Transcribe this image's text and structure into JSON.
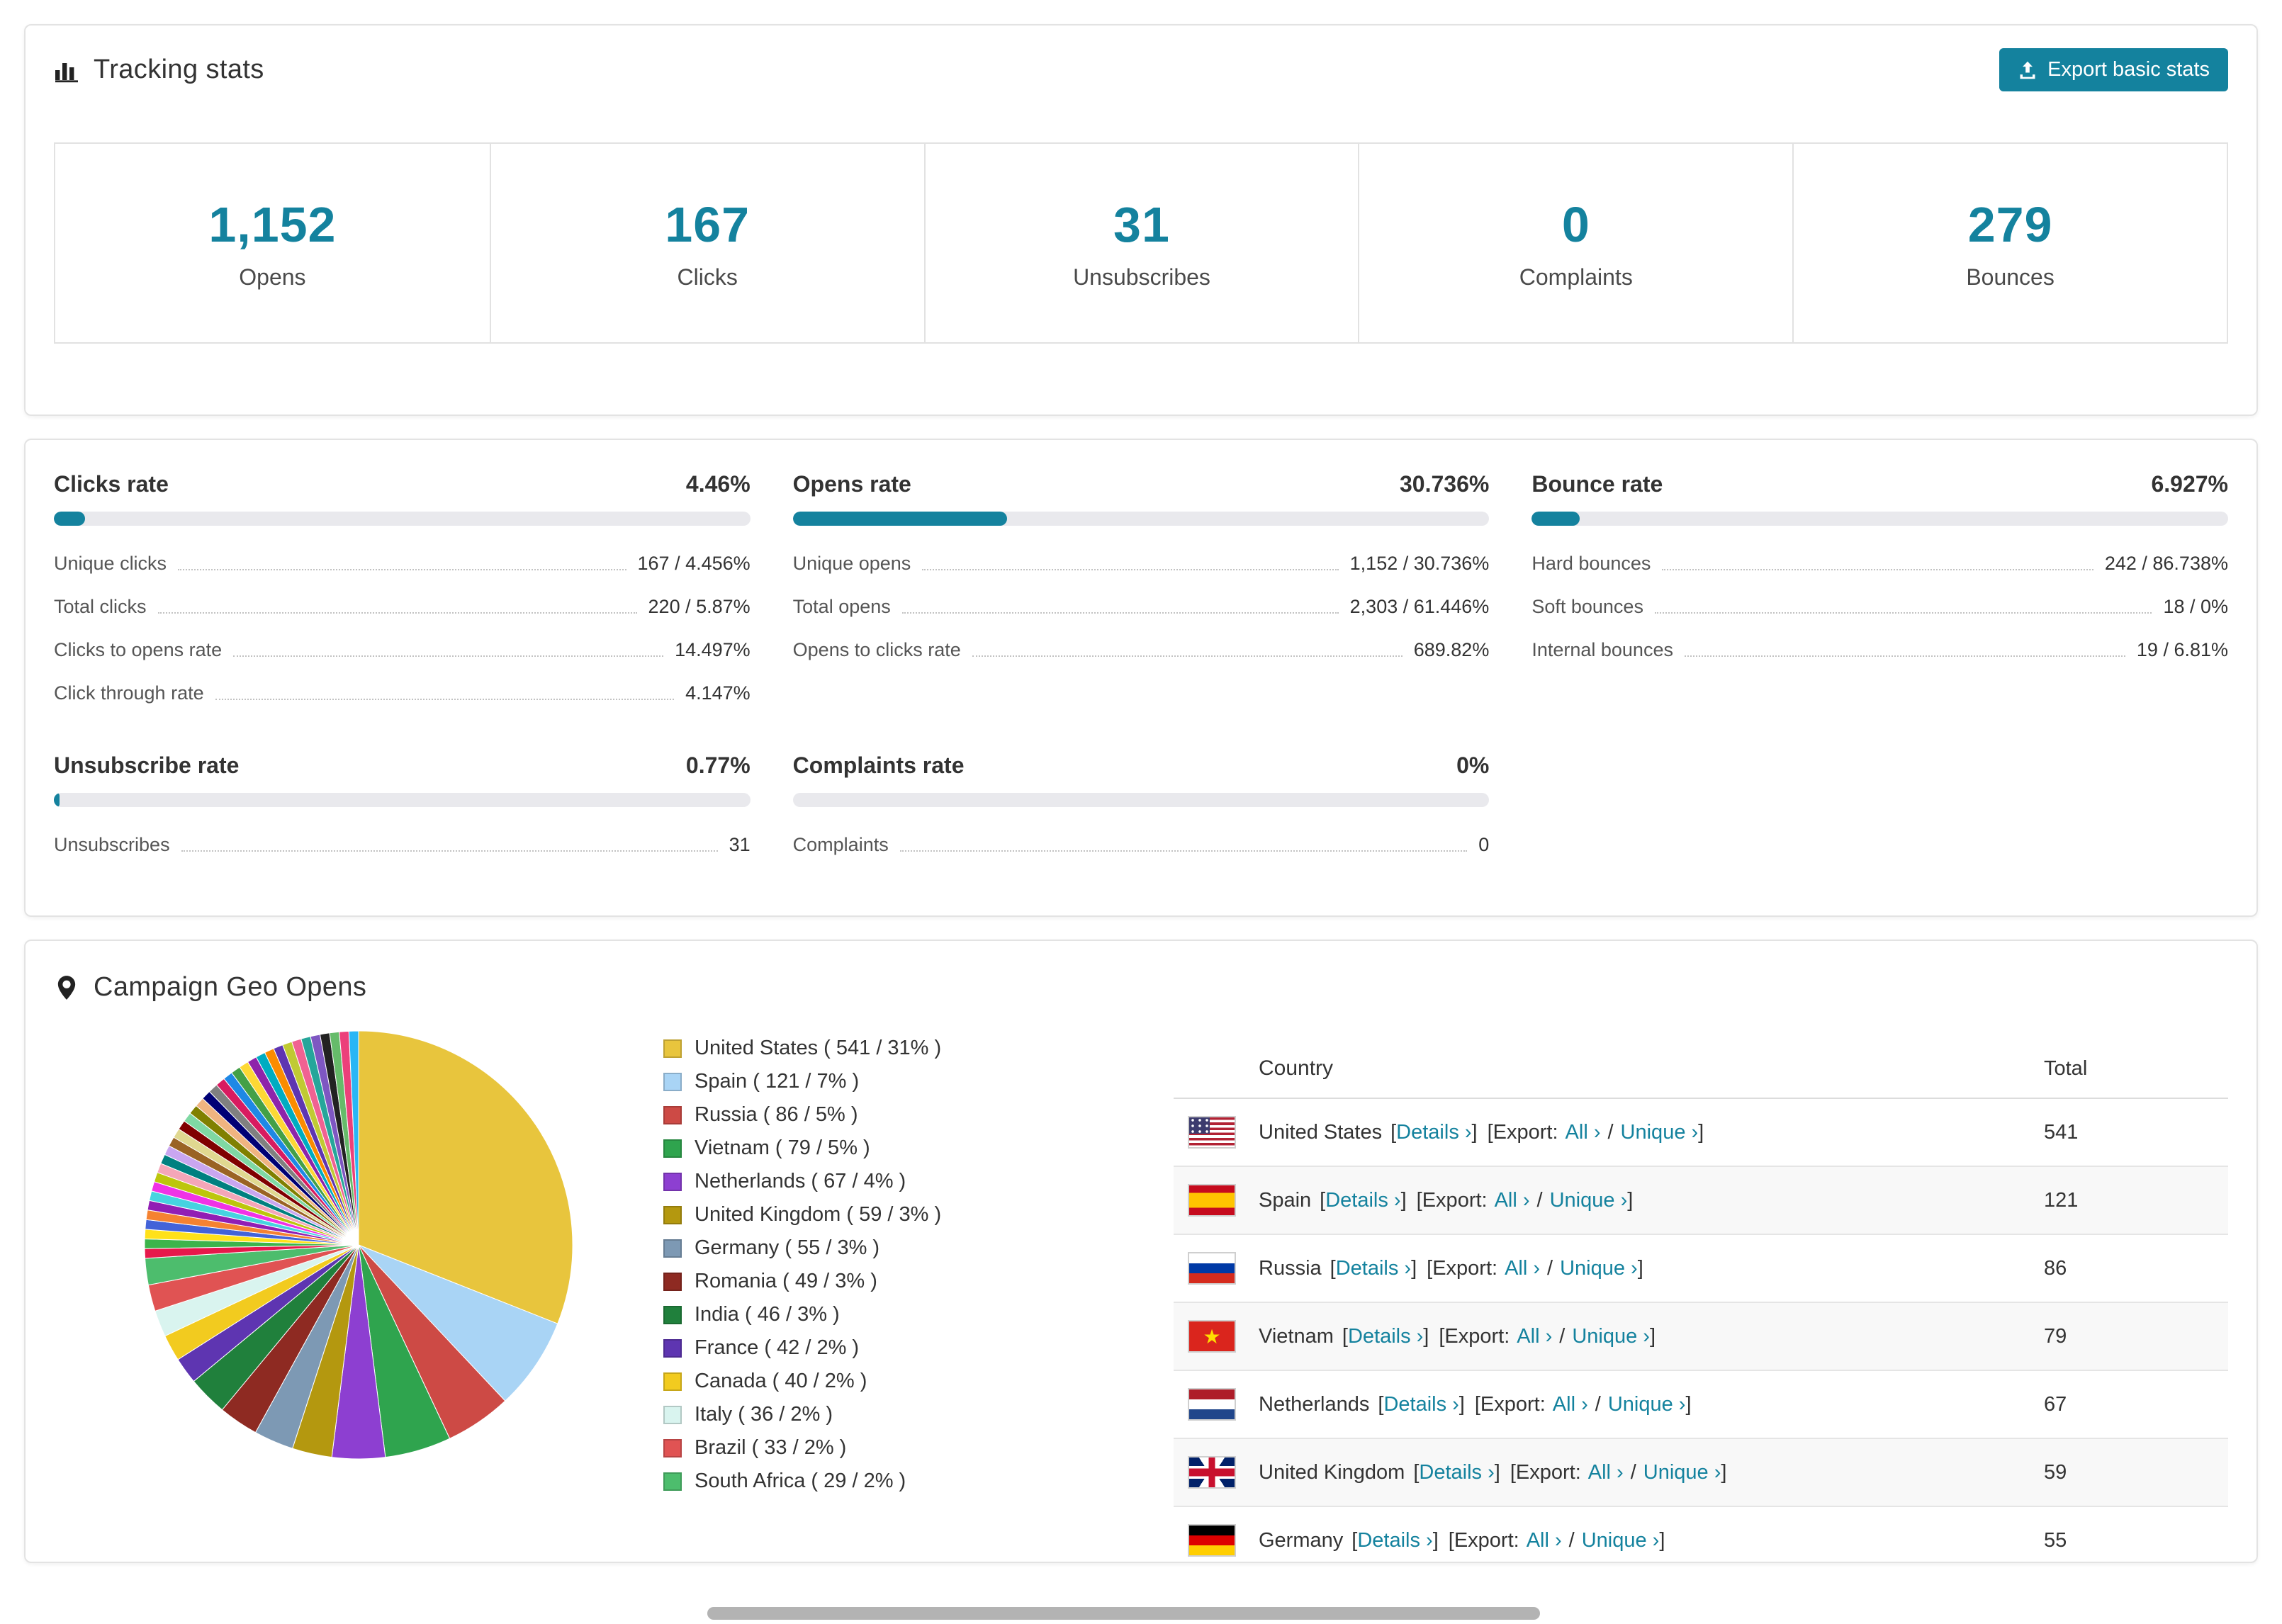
{
  "colors": {
    "accent": "#14829e"
  },
  "tracking": {
    "title": "Tracking stats",
    "export_button": "Export basic stats",
    "stats": [
      {
        "value": "1,152",
        "label": "Opens"
      },
      {
        "value": "167",
        "label": "Clicks"
      },
      {
        "value": "31",
        "label": "Unsubscribes"
      },
      {
        "value": "0",
        "label": "Complaints"
      },
      {
        "value": "279",
        "label": "Bounces"
      }
    ]
  },
  "rates": {
    "panels": [
      {
        "title": "Clicks rate",
        "value": "4.46%",
        "pct": 4.46,
        "rows": [
          {
            "label": "Unique clicks",
            "value": "167 / 4.456%"
          },
          {
            "label": "Total clicks",
            "value": "220 / 5.87%"
          },
          {
            "label": "Clicks to opens rate",
            "value": "14.497%"
          },
          {
            "label": "Click through rate",
            "value": "4.147%"
          }
        ]
      },
      {
        "title": "Opens rate",
        "value": "30.736%",
        "pct": 30.736,
        "rows": [
          {
            "label": "Unique opens",
            "value": "1,152 / 30.736%"
          },
          {
            "label": "Total opens",
            "value": "2,303 / 61.446%"
          },
          {
            "label": "Opens to clicks rate",
            "value": "689.82%"
          }
        ]
      },
      {
        "title": "Bounce rate",
        "value": "6.927%",
        "pct": 6.927,
        "rows": [
          {
            "label": "Hard bounces",
            "value": "242 / 86.738%"
          },
          {
            "label": "Soft bounces",
            "value": "18 / 0%"
          },
          {
            "label": "Internal bounces",
            "value": "19 / 6.81%"
          }
        ]
      },
      {
        "title": "Unsubscribe rate",
        "value": "0.77%",
        "pct": 0.77,
        "rows": [
          {
            "label": "Unsubscribes",
            "value": "31"
          }
        ]
      },
      {
        "title": "Complaints rate",
        "value": "0%",
        "pct": 0,
        "rows": [
          {
            "label": "Complaints",
            "value": "0"
          }
        ]
      }
    ]
  },
  "geo": {
    "title": "Campaign Geo Opens",
    "table": {
      "headers": {
        "country": "Country",
        "total": "Total"
      },
      "labels": {
        "details": "Details",
        "export": "Export:",
        "all": "All",
        "unique": "Unique",
        "chevron": "›",
        "open_bracket": "[",
        "close_bracket": "]",
        "slash": "/"
      },
      "rows": [
        {
          "flag": "us",
          "country": "United States",
          "total": "541"
        },
        {
          "flag": "es",
          "country": "Spain",
          "total": "121"
        },
        {
          "flag": "ru",
          "country": "Russia",
          "total": "86"
        },
        {
          "flag": "vn",
          "country": "Vietnam",
          "total": "79"
        },
        {
          "flag": "nl",
          "country": "Netherlands",
          "total": "67"
        },
        {
          "flag": "gb",
          "country": "United Kingdom",
          "total": "59"
        },
        {
          "flag": "de",
          "country": "Germany",
          "total": "55"
        }
      ]
    }
  },
  "chart_data": {
    "type": "pie",
    "title": "Campaign Geo Opens",
    "unit": "opens",
    "legend_position": "right",
    "slices": [
      {
        "label": "United States",
        "value": 541,
        "pct": 31,
        "color": "#e8c53d",
        "legend": "United States ( 541 / 31% )"
      },
      {
        "label": "Spain",
        "value": 121,
        "pct": 7,
        "color": "#a9d4f5",
        "legend": "Spain ( 121 / 7% )"
      },
      {
        "label": "Russia",
        "value": 86,
        "pct": 5,
        "color": "#cd4a45",
        "legend": "Russia ( 86 / 5% )"
      },
      {
        "label": "Vietnam",
        "value": 79,
        "pct": 5,
        "color": "#2fa44e",
        "legend": "Vietnam ( 79 / 5% )"
      },
      {
        "label": "Netherlands",
        "value": 67,
        "pct": 4,
        "color": "#8d3fd1",
        "legend": "Netherlands ( 67 / 4% )"
      },
      {
        "label": "United Kingdom",
        "value": 59,
        "pct": 3,
        "color": "#b4980f",
        "legend": "United Kingdom ( 59 / 3% )"
      },
      {
        "label": "Germany",
        "value": 55,
        "pct": 3,
        "color": "#7d99b4",
        "legend": "Germany ( 55 / 3% )"
      },
      {
        "label": "Romania",
        "value": 49,
        "pct": 3,
        "color": "#8e2a22",
        "legend": "Romania ( 49 / 3% )"
      },
      {
        "label": "India",
        "value": 46,
        "pct": 3,
        "color": "#20803c",
        "legend": "India ( 46 / 3% )"
      },
      {
        "label": "France",
        "value": 42,
        "pct": 2,
        "color": "#5e35b1",
        "legend": "France ( 42 / 2% )"
      },
      {
        "label": "Canada",
        "value": 40,
        "pct": 2,
        "color": "#f2cb1f",
        "legend": "Canada ( 40 / 2% )"
      },
      {
        "label": "Italy",
        "value": 36,
        "pct": 2,
        "color": "#d9f4ef",
        "legend": "Italy ( 36 / 2% )"
      },
      {
        "label": "Brazil",
        "value": 33,
        "pct": 2,
        "color": "#e05353",
        "legend": "Brazil ( 33 / 2% )"
      },
      {
        "label": "South Africa",
        "value": 29,
        "pct": 2,
        "color": "#4dbd6d",
        "legend": "South Africa ( 29 / 2% )"
      }
    ],
    "others": {
      "total_pct": 26,
      "count": 36,
      "colors": [
        "#e6194b",
        "#3cb44b",
        "#ffe119",
        "#4363d8",
        "#f58231",
        "#911eb4",
        "#46d3e0",
        "#f032e6",
        "#bcc60c",
        "#f4a6b8",
        "#008080",
        "#c9a6f0",
        "#9a6324",
        "#e0d890",
        "#800000",
        "#7fd8a3",
        "#808000",
        "#f0b480",
        "#000075",
        "#808080",
        "#d81b60",
        "#1e88e5",
        "#43a047",
        "#fdd835",
        "#8e24aa",
        "#00acc1",
        "#fb8c00",
        "#5e35b1",
        "#c0ca33",
        "#f06292",
        "#26a69a",
        "#7e57c2",
        "#222222",
        "#66bb6a",
        "#ec407a",
        "#29b6f6"
      ]
    }
  }
}
